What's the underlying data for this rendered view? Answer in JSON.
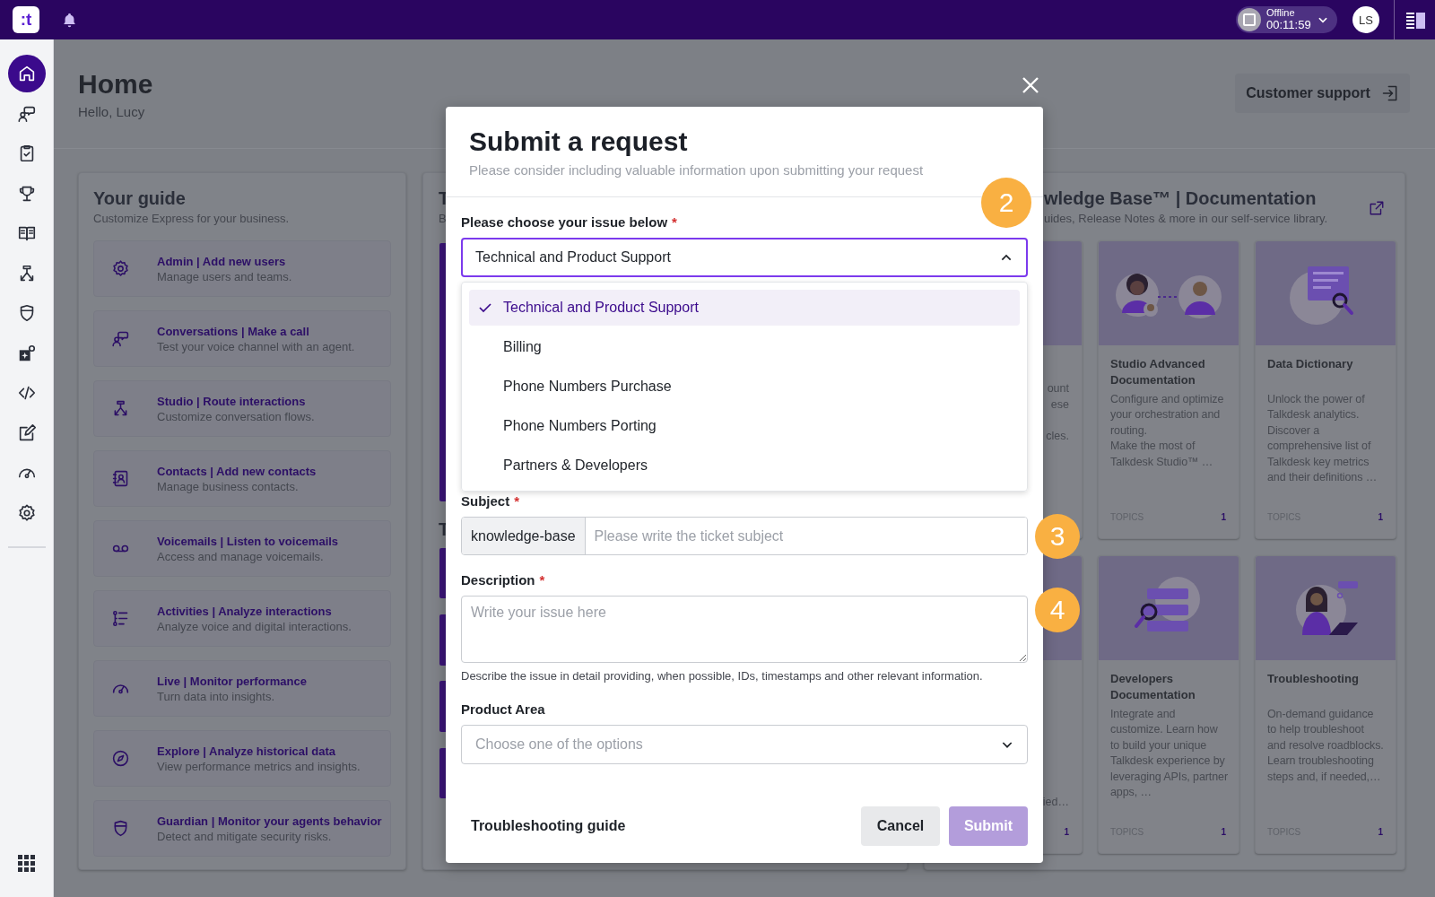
{
  "topbar": {
    "logo": ":t",
    "status": {
      "label": "Offline",
      "timer": "00:11:59"
    },
    "avatar": "LS"
  },
  "nav": {
    "items": [
      {
        "selected": true
      },
      {
        "selected": false
      },
      {
        "selected": false
      },
      {
        "selected": false
      },
      {
        "selected": false
      },
      {
        "selected": false
      },
      {
        "selected": false
      },
      {
        "selected": false
      },
      {
        "selected": false
      },
      {
        "selected": false
      },
      {
        "selected": false
      },
      {
        "selected": false
      }
    ]
  },
  "page": {
    "title": "Home",
    "greeting": "Hello, Lucy",
    "support_button": "Customer support"
  },
  "guide": {
    "title": "Your guide",
    "subtitle": "Customize Express for your business.",
    "items": [
      {
        "title": "Admin | Add new users",
        "text": "Manage users and teams."
      },
      {
        "title": "Conversations | Make a call",
        "text": "Test your voice channel with an agent."
      },
      {
        "title": "Studio | Route interactions",
        "text": "Customize conversation flows."
      },
      {
        "title": "Contacts | Add new contacts",
        "text": "Manage business contacts."
      },
      {
        "title": "Voicemails | Listen to voicemails",
        "text": "Access and manage voicemails."
      },
      {
        "title": "Activities | Analyze interactions",
        "text": "Analyze voice and digital interactions."
      },
      {
        "title": "Live | Monitor performance",
        "text": "Turn data into insights."
      },
      {
        "title": "Explore | Analyze historical data",
        "text": "View performance metrics and insights."
      },
      {
        "title": "Guardian | Monitor your agents behavior",
        "text": "Detect and mitigate security risks."
      }
    ]
  },
  "middle_panel": {
    "title": "T",
    "subtitle": "B",
    "section_title": "T"
  },
  "knowledge_base": {
    "title": "wledge Base™ | Documentation",
    "subtitle": "uides, Release Notes & more in our self-service library.",
    "cards": [
      {
        "kind": "partial",
        "lines": [
          "ount",
          "ese",
          "cles."
        ]
      },
      {
        "kind": "full",
        "title": "Studio Advanced Documentation",
        "text": "Configure and optimize your orchestration and routing.\nMake the most of Talkdesk Studio™ …",
        "topics": "TOPICS",
        "count": "1"
      },
      {
        "kind": "full",
        "title": "Data Dictionary",
        "text": "Unlock the power of Talkdesk analytics. Discover a comprehensive list of Talkdesk key metrics and their definitions …",
        "topics": "TOPICS",
        "count": "1"
      },
      {
        "kind": "partial",
        "lines": [
          "ied…"
        ],
        "count": "1"
      },
      {
        "kind": "full",
        "title": "Developers Documentation",
        "text": "Integrate and customize. Learn how to build your unique Talkdesk experience by leveraging APIs, partner apps, …",
        "topics": "TOPICS",
        "count": "1"
      },
      {
        "kind": "full",
        "title": "Troubleshooting",
        "text": "On-demand guidance to help troubleshoot and resolve roadblocks.\nLearn troubleshooting steps and, if needed,…",
        "topics": "TOPICS",
        "count": "1"
      }
    ]
  },
  "modal": {
    "title": "Submit a request",
    "subtitle": "Please consider including valuable information upon submitting your request",
    "issue": {
      "label": "Please choose your issue below",
      "required_mark": "*",
      "value": "Technical and Product Support",
      "expanded": true,
      "options": [
        {
          "label": "Technical and Product Support",
          "selected": true
        },
        {
          "label": "Billing",
          "selected": false
        },
        {
          "label": "Phone Numbers Purchase",
          "selected": false
        },
        {
          "label": "Phone Numbers Porting",
          "selected": false
        },
        {
          "label": "Partners & Developers",
          "selected": false
        }
      ]
    },
    "subject": {
      "label": "Subject",
      "required_mark": "*",
      "prefix": "knowledge-base",
      "placeholder": "Please write the ticket subject"
    },
    "description": {
      "label": "Description",
      "required_mark": "*",
      "placeholder": "Write your issue here",
      "help": "Describe the issue in detail providing, when possible, IDs, timestamps and other relevant information."
    },
    "product_area": {
      "label": "Product Area",
      "placeholder": "Choose one of the options"
    },
    "footer": {
      "link": "Troubleshooting guide",
      "cancel": "Cancel",
      "submit": {
        "label": "Submit",
        "disabled": true
      }
    }
  },
  "badges": [
    {
      "label": "2"
    },
    {
      "label": "3"
    },
    {
      "label": "4"
    }
  ]
}
